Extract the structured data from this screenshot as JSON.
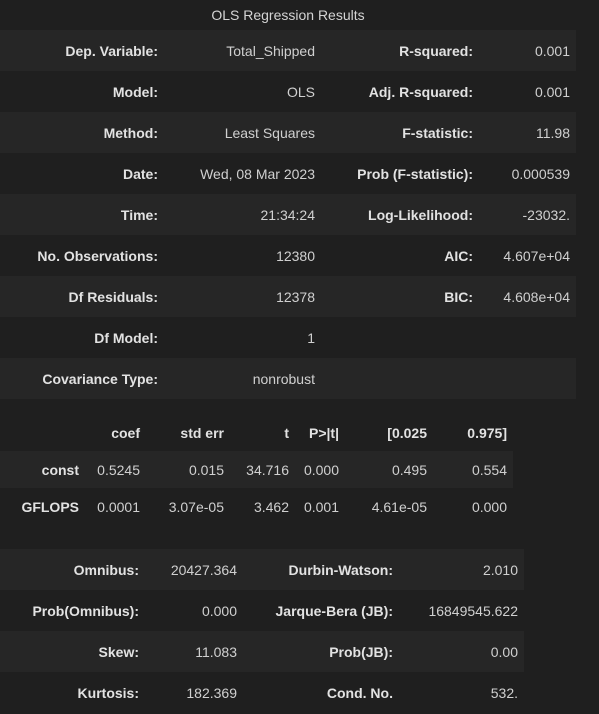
{
  "title": "OLS Regression Results",
  "summary": [
    {
      "l1": "Dep. Variable:",
      "v1": "Total_Shipped",
      "l2": "R-squared:",
      "v2": "0.001"
    },
    {
      "l1": "Model:",
      "v1": "OLS",
      "l2": "Adj. R-squared:",
      "v2": "0.001"
    },
    {
      "l1": "Method:",
      "v1": "Least Squares",
      "l2": "F-statistic:",
      "v2": "11.98"
    },
    {
      "l1": "Date:",
      "v1": "Wed, 08 Mar 2023",
      "l2": "Prob (F-statistic):",
      "v2": "0.000539"
    },
    {
      "l1": "Time:",
      "v1": "21:34:24",
      "l2": "Log-Likelihood:",
      "v2": "-23032."
    },
    {
      "l1": "No. Observations:",
      "v1": "12380",
      "l2": "AIC:",
      "v2": "4.607e+04"
    },
    {
      "l1": "Df Residuals:",
      "v1": "12378",
      "l2": "BIC:",
      "v2": "4.608e+04"
    },
    {
      "l1": "Df Model:",
      "v1": "1",
      "l2": "",
      "v2": ""
    },
    {
      "l1": "Covariance Type:",
      "v1": "nonrobust",
      "l2": "",
      "v2": ""
    }
  ],
  "coef": {
    "headers": [
      "",
      "coef",
      "std err",
      "t",
      "P>|t|",
      "[0.025",
      "0.975]"
    ],
    "rows": [
      [
        "const",
        "0.5245",
        "0.015",
        "34.716",
        "0.000",
        "0.495",
        "0.554"
      ],
      [
        "GFLOPS",
        "0.0001",
        "3.07e-05",
        "3.462",
        "0.001",
        "4.61e-05",
        "0.000"
      ]
    ]
  },
  "diag": [
    {
      "l1": "Omnibus:",
      "v1": "20427.364",
      "l2": "Durbin-Watson:",
      "v2": "2.010"
    },
    {
      "l1": "Prob(Omnibus):",
      "v1": "0.000",
      "l2": "Jarque-Bera (JB):",
      "v2": "16849545.622"
    },
    {
      "l1": "Skew:",
      "v1": "11.083",
      "l2": "Prob(JB):",
      "v2": "0.00"
    },
    {
      "l1": "Kurtosis:",
      "v1": "182.369",
      "l2": "Cond. No.",
      "v2": "532."
    }
  ]
}
